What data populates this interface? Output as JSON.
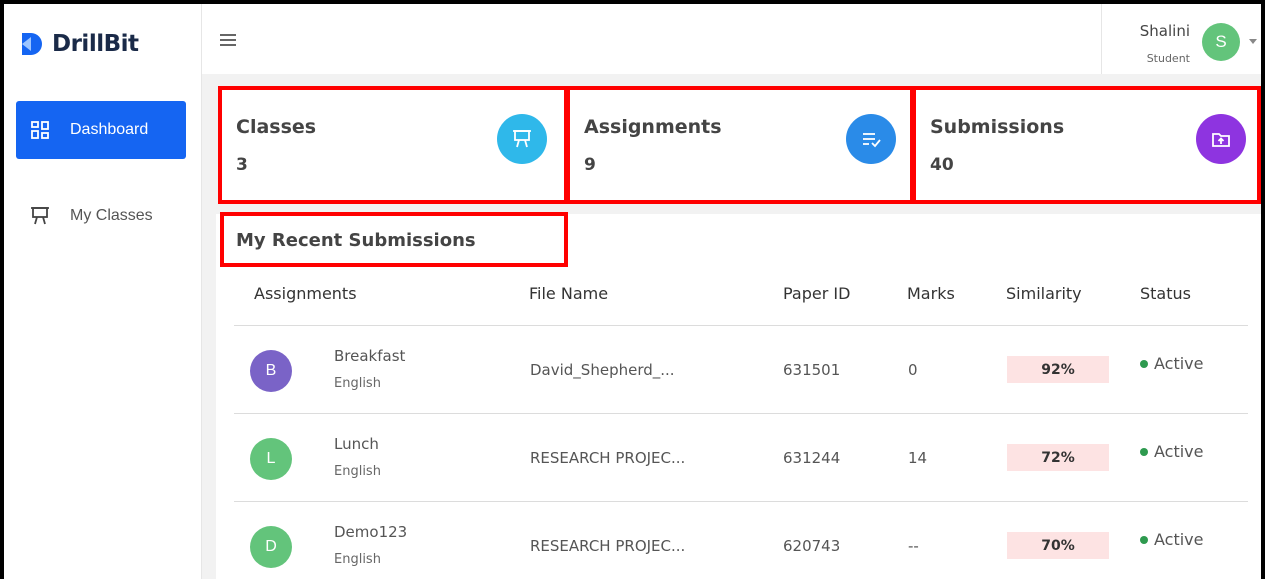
{
  "brand": {
    "name": "DrillBit"
  },
  "sidebar": {
    "items": [
      {
        "label": "Dashboard",
        "icon": "dashboard-grid-icon",
        "active": true
      },
      {
        "label": "My Classes",
        "icon": "presentation-board-icon",
        "active": false
      }
    ]
  },
  "user": {
    "name": "Shalini",
    "role": "Student",
    "initial": "S",
    "avatar_color": "#63c47b"
  },
  "cards": [
    {
      "title": "Classes",
      "count": "3",
      "icon": "presentation-board-icon",
      "color": "#2fb8ea"
    },
    {
      "title": "Assignments",
      "count": "9",
      "icon": "checklist-icon",
      "color": "#2a8be8"
    },
    {
      "title": "Submissions",
      "count": "40",
      "icon": "folder-upload-icon",
      "color": "#8e34e0"
    }
  ],
  "recent": {
    "title": "My Recent Submissions",
    "headers": [
      "Assignments",
      "File Name",
      "Paper ID",
      "Marks",
      "Similarity",
      "Status"
    ],
    "rows": [
      {
        "initial": "B",
        "avatar_color": "#7a63c7",
        "name": "Breakfast",
        "subject": "English",
        "file": "David_Shepherd_...",
        "paper_id": "631501",
        "marks": "0",
        "similarity": "92%",
        "status": "Active"
      },
      {
        "initial": "L",
        "avatar_color": "#63c47b",
        "name": "Lunch",
        "subject": "English",
        "file": "RESEARCH PROJEC...",
        "paper_id": "631244",
        "marks": "14",
        "similarity": "72%",
        "status": "Active"
      },
      {
        "initial": "D",
        "avatar_color": "#63c47b",
        "name": "Demo123",
        "subject": "English",
        "file": "RESEARCH PROJEC...",
        "paper_id": "620743",
        "marks": "--",
        "similarity": "70%",
        "status": "Active"
      }
    ]
  },
  "colors": {
    "primary": "#1565f2",
    "highlight_border": "#ff0000",
    "status_active": "#2e9a4f",
    "similarity_bg": "#fde3e3"
  }
}
